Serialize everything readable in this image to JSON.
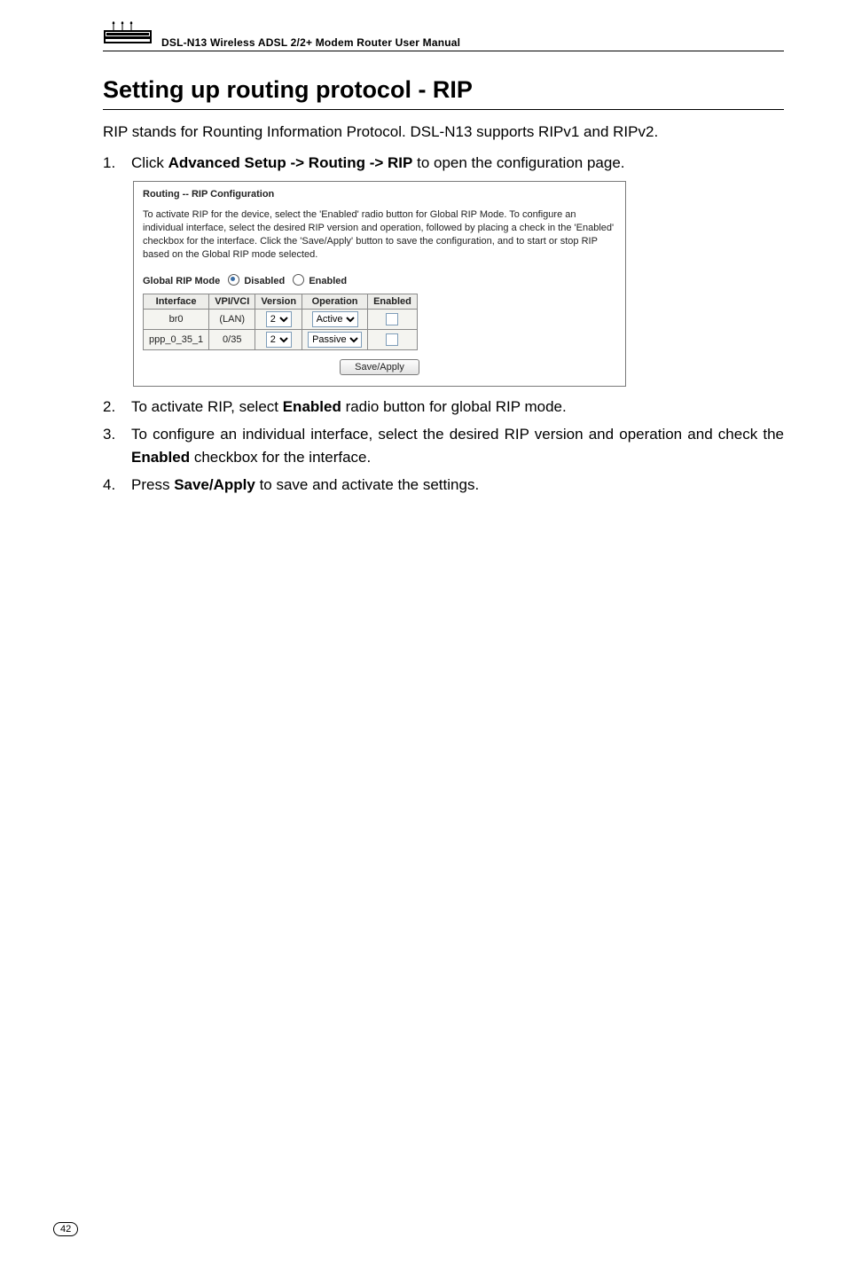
{
  "header": {
    "manual_title": "DSL-N13 Wireless ADSL 2/2+ Modem Router User Manual"
  },
  "section": {
    "title": "Setting up routing protocol - RIP",
    "intro": "RIP stands for Rounting Information Protocol. DSL-N13 supports RIPv1 and RIPv2."
  },
  "steps": [
    {
      "num": "1.",
      "pre": "Click ",
      "bold": "Advanced Setup -> Routing -> RIP",
      "post": " to open the configuration page."
    },
    {
      "num": "2.",
      "pre": "To activate RIP, select ",
      "bold": "Enabled",
      "post": " radio button for global RIP mode."
    },
    {
      "num": "3.",
      "pre": "To configure an individual interface, select the desired RIP version and operation and check the ",
      "bold": "Enabled",
      "post": " checkbox for the interface."
    },
    {
      "num": "4.",
      "pre": "Press ",
      "bold": "Save/Apply",
      "post": " to save and activate the settings."
    }
  ],
  "shot": {
    "title": "Routing -- RIP Configuration",
    "desc": "To activate RIP for the device, select the 'Enabled' radio button for Global RIP Mode. To configure an individual interface, select the desired RIP version and operation, followed by placing a check in the 'Enabled' checkbox for the interface. Click the 'Save/Apply' button to save the configuration, and to start or stop RIP based on the Global RIP mode selected.",
    "mode_label": "Global RIP Mode",
    "mode_disabled": "Disabled",
    "mode_enabled": "Enabled",
    "columns": [
      "Interface",
      "VPI/VCI",
      "Version",
      "Operation",
      "Enabled"
    ],
    "rows": [
      {
        "iface": "br0",
        "vpivci": "(LAN)",
        "version": "2",
        "operation": "Active"
      },
      {
        "iface": "ppp_0_35_1",
        "vpivci": "0/35",
        "version": "2",
        "operation": "Passive"
      }
    ],
    "button": "Save/Apply"
  },
  "page_number": "42"
}
